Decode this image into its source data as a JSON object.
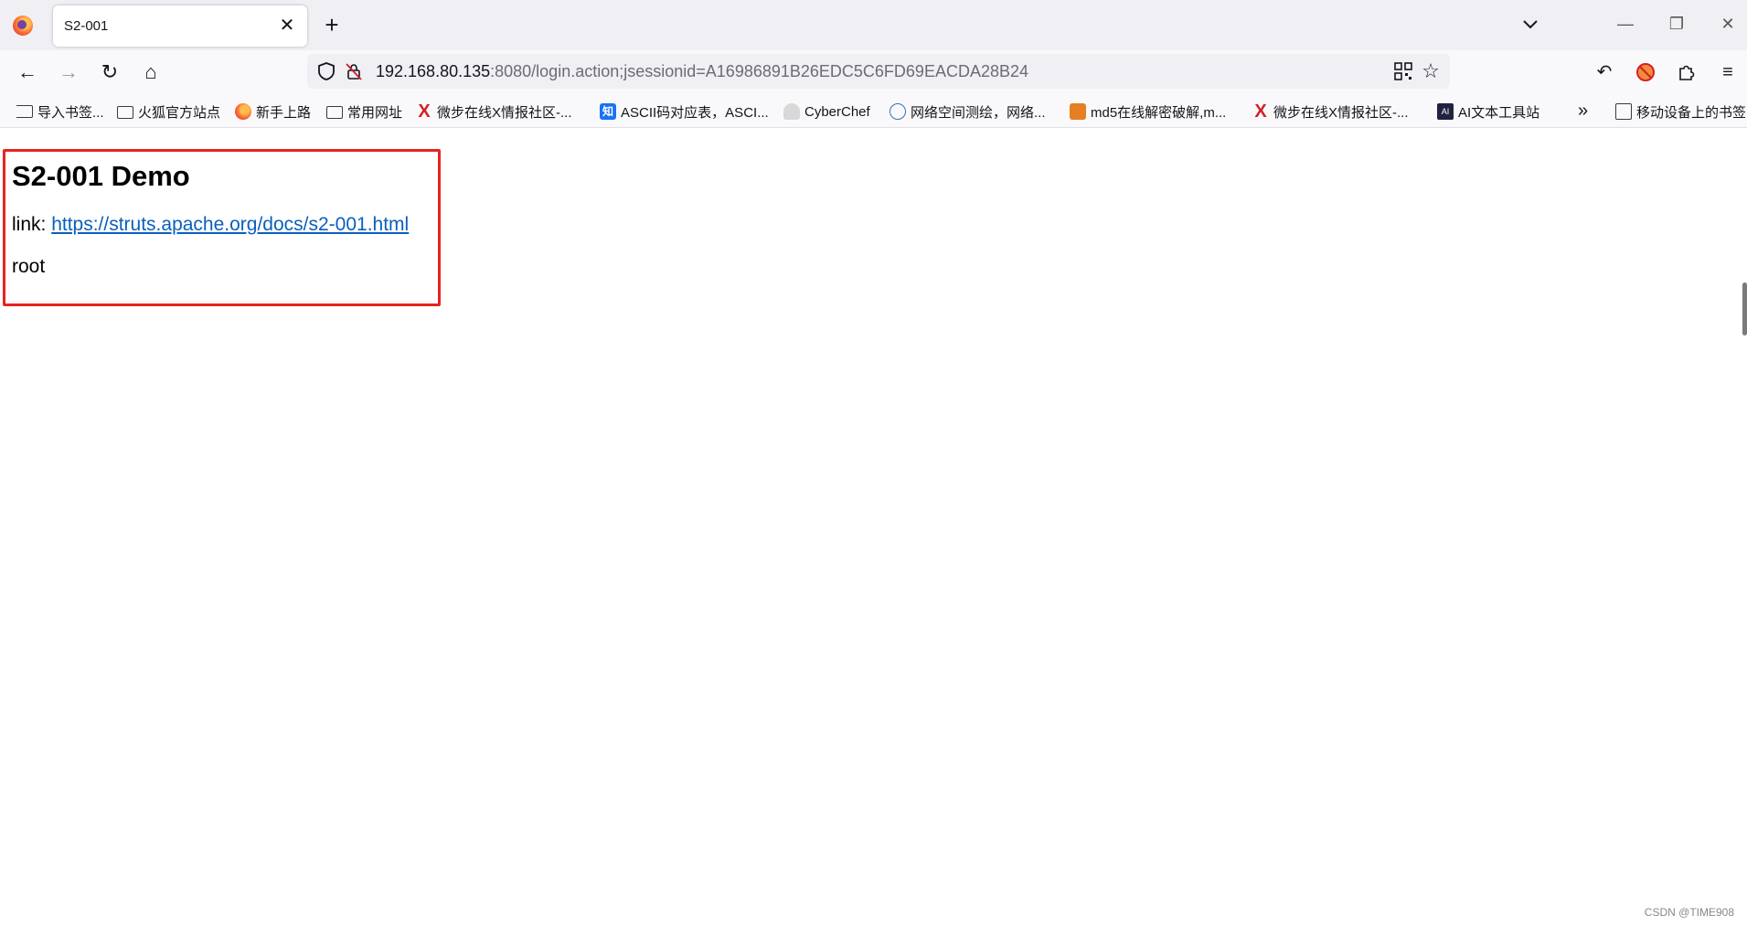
{
  "tab": {
    "title": "S2-001",
    "close": "✕",
    "new_tab": "+"
  },
  "window": {
    "minimize": "—",
    "restore": "❐",
    "close": "✕"
  },
  "nav": {
    "back": "←",
    "forward": "→",
    "reload": "↻",
    "home": "⌂",
    "url_host": "192.168.80.135",
    "url_rest": ":8080/login.action;jsessionid=A16986891B26EDC5C6FD69EACDA28B24",
    "bookmark_star": "☆",
    "undo": "↶",
    "extensions": "⚲",
    "menu": "≡"
  },
  "bookmarks": {
    "items": [
      {
        "label": "导入书签...",
        "icon": "import-icon"
      },
      {
        "label": "火狐官方站点",
        "icon": "folder-icon"
      },
      {
        "label": "新手上路",
        "icon": "firefox-icon"
      },
      {
        "label": "常用网址",
        "icon": "folder-icon"
      },
      {
        "label": "微步在线X情报社区-...",
        "icon": "x-logo-icon"
      },
      {
        "label": "ASCII码对应表，ASCI...",
        "icon": "zhihu-icon",
        "icon_text": "知"
      },
      {
        "label": "CyberChef",
        "icon": "chef-icon"
      },
      {
        "label": "网络空间测绘，网络...",
        "icon": "globe-icon"
      },
      {
        "label": "md5在线解密破解,m...",
        "icon": "md5-icon"
      },
      {
        "label": "微步在线X情报社区-...",
        "icon": "x-logo-icon"
      },
      {
        "label": "AI文本工具站",
        "icon": "ai-icon",
        "icon_text": "AI"
      }
    ],
    "more": "»",
    "mobile": "移动设备上的书签"
  },
  "page": {
    "heading": "S2-001 Demo",
    "link_prefix": "link: ",
    "link_text": "https://struts.apache.org/docs/s2-001.html",
    "result": "root"
  },
  "watermark": "CSDN @TIME908",
  "colors": {
    "highlight_border": "#e8221f",
    "link": "#0b5fbd"
  }
}
